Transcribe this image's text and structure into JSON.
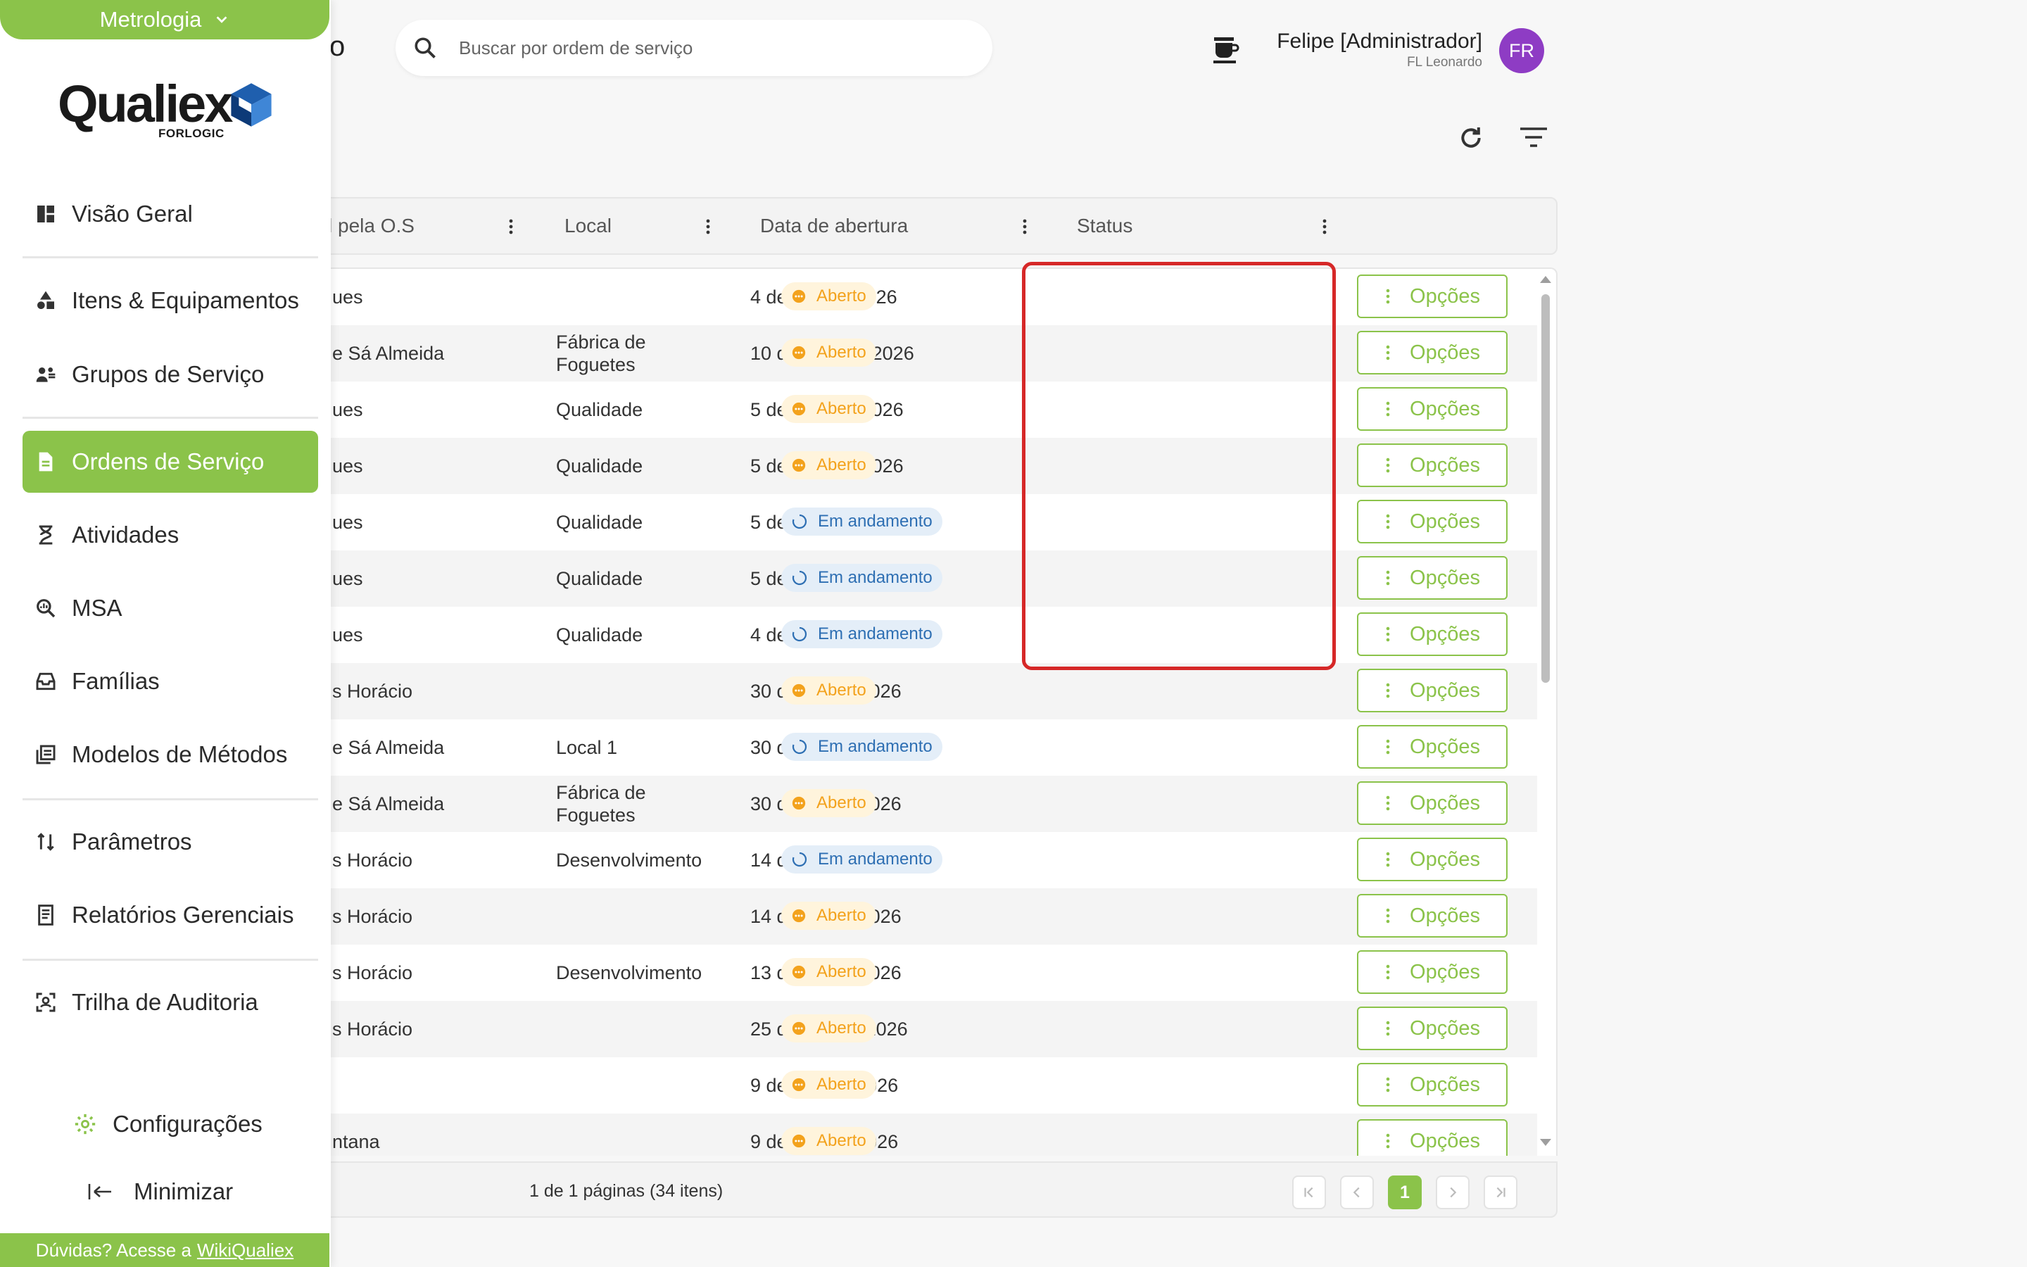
{
  "sidebar": {
    "module": "Metrologia",
    "logo": {
      "word": "Qualiex",
      "sub": "FORLOGIC"
    },
    "items": [
      {
        "label": "Visão Geral",
        "icon": "dashboard-icon"
      },
      {
        "label": "Itens & Equipamentos",
        "icon": "shapes-icon"
      },
      {
        "label": "Grupos de Serviço",
        "icon": "group-icon"
      },
      {
        "label": "Ordens de Serviço",
        "icon": "document-icon",
        "active": true
      },
      {
        "label": "Atividades",
        "icon": "hourglass-icon"
      },
      {
        "label": "MSA",
        "icon": "magnifier-icon"
      },
      {
        "label": "Famílias",
        "icon": "tray-icon"
      },
      {
        "label": "Modelos de Métodos",
        "icon": "library-icon"
      },
      {
        "label": "Parâmetros",
        "icon": "sort-arrows-icon"
      },
      {
        "label": "Relatórios Gerenciais",
        "icon": "report-icon"
      },
      {
        "label": "Trilha de Auditoria",
        "icon": "scan-icon"
      }
    ],
    "config_label": "Configurações",
    "minimize_label": "Minimizar",
    "help_text": "Dúvidas? Acesse a",
    "help_link": "WikiQualiex"
  },
  "header": {
    "title_fragment": "ço",
    "search_placeholder": "Buscar por ordem de serviço",
    "user_name": "Felipe [Administrador]",
    "user_org": "FL Leonardo",
    "avatar_initials": "FR"
  },
  "colors": {
    "accent": "#8bc34a",
    "status_open": "#f3a21c",
    "status_progress": "#2e6fb3",
    "highlight": "#d62828",
    "avatar": "#8e3cc4"
  },
  "table": {
    "columns": [
      "l pela O.S",
      "Local",
      "Data de abertura",
      "Status"
    ],
    "options_label": "Opções",
    "rows": [
      {
        "responsavel": "ues",
        "local": "",
        "date": "4 de set. de 2026",
        "status": "Aberto"
      },
      {
        "responsavel": "e Sá Almeida",
        "local": "Fábrica de Foguetes",
        "date": "10 de ago. de 2026",
        "status": "Aberto"
      },
      {
        "responsavel": "ues",
        "local": "Qualidade",
        "date": "5 de ago. de 2026",
        "status": "Aberto"
      },
      {
        "responsavel": "ues",
        "local": "Qualidade",
        "date": "5 de ago. de 2026",
        "status": "Aberto"
      },
      {
        "responsavel": "ues",
        "local": "Qualidade",
        "date": "5 de ago. de 2026",
        "status": "Em andamento"
      },
      {
        "responsavel": "ues",
        "local": "Qualidade",
        "date": "5 de ago. de 2026",
        "status": "Em andamento"
      },
      {
        "responsavel": "ues",
        "local": "Qualidade",
        "date": "4 de ago. de 2026",
        "status": "Em andamento"
      },
      {
        "responsavel": "s Horácio",
        "local": "",
        "date": "30 de jul. de 2026",
        "status": "Aberto"
      },
      {
        "responsavel": "e Sá Almeida",
        "local": "Local 1",
        "date": "30 de jul. de 2026",
        "status": "Em andamento"
      },
      {
        "responsavel": "e Sá Almeida",
        "local": "Fábrica de Foguetes",
        "date": "30 de jul. de 2026",
        "status": "Aberto"
      },
      {
        "responsavel": "s Horácio",
        "local": "Desenvolvimento",
        "date": "14 de jul. de 2026",
        "status": "Em andamento"
      },
      {
        "responsavel": "s Horácio",
        "local": "",
        "date": "14 de jul. de 2026",
        "status": "Aberto"
      },
      {
        "responsavel": "s Horácio",
        "local": "Desenvolvimento",
        "date": "13 de jul. de 2026",
        "status": "Aberto"
      },
      {
        "responsavel": "s Horácio",
        "local": "",
        "date": "25 de jun. de 2026",
        "status": "Aberto"
      },
      {
        "responsavel": "",
        "local": "",
        "date": "9 de abr. de 2026",
        "status": "Aberto"
      },
      {
        "responsavel": "ntana",
        "local": "",
        "date": "9 de abr. de 2026",
        "status": "Aberto"
      }
    ]
  },
  "pagination": {
    "info": "1 de 1 páginas (34 itens)",
    "current_page": "1"
  }
}
